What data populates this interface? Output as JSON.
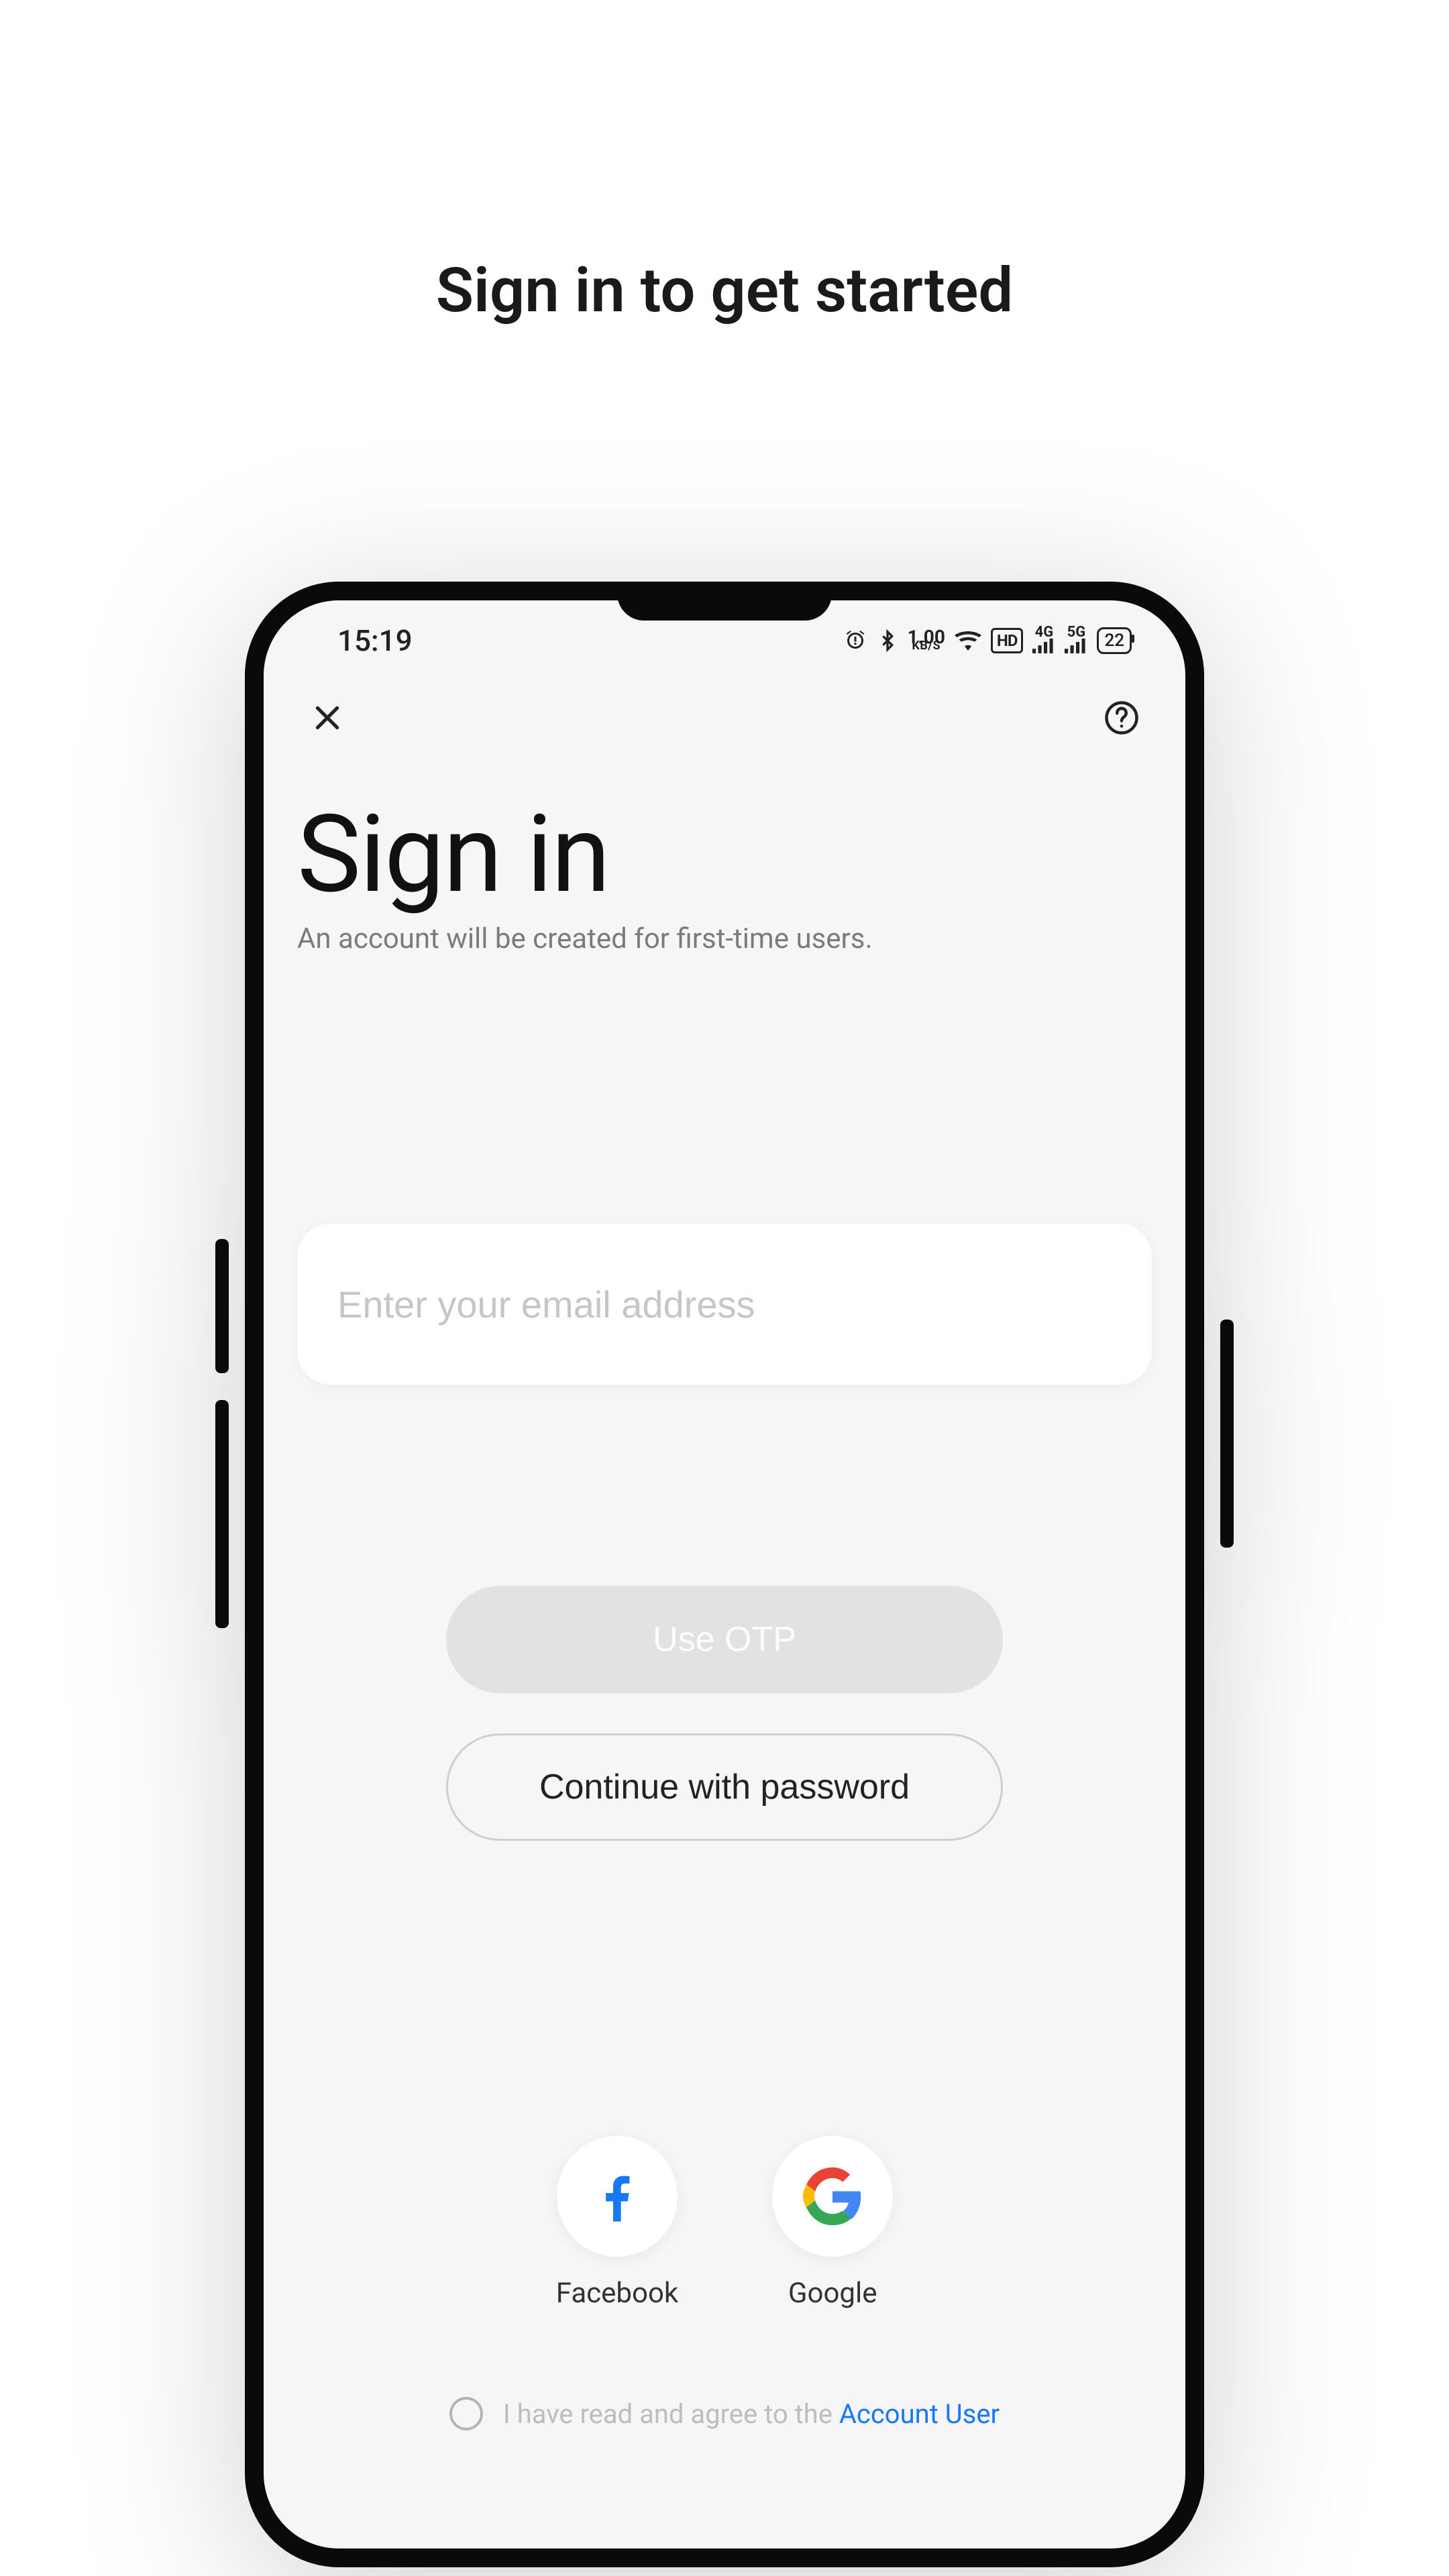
{
  "page": {
    "heading": "Sign in to get started"
  },
  "statusbar": {
    "time": "15:19",
    "data_rate_value": "1.00",
    "data_rate_unit": "KB/S",
    "hd_label": "HD",
    "net1_label": "4G",
    "net2_label": "5G",
    "battery": "22"
  },
  "screen": {
    "title": "Sign in",
    "subtitle": "An account will be created for first-time users."
  },
  "form": {
    "email_placeholder": "Enter your email address",
    "otp_label": "Use OTP",
    "password_label": "Continue with password"
  },
  "social": {
    "facebook_label": "Facebook",
    "google_label": "Google"
  },
  "agree": {
    "prefix": "I have read and agree to the ",
    "link": "Account User"
  }
}
